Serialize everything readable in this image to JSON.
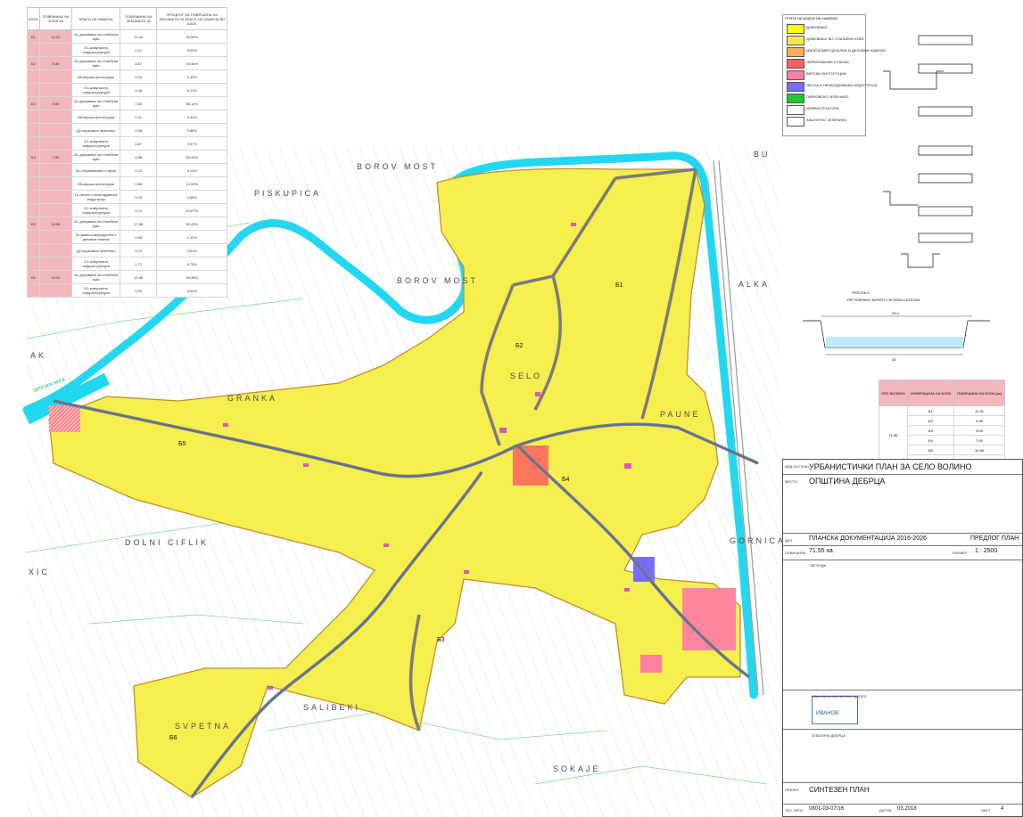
{
  "block_table": {
    "headers": [
      "БЛОК",
      "ПОВРШИНА НА БЛОК ха",
      "КЛАСА НА НАМЕНА",
      "ПОВРШИНА НА ЗЕМЈИШТЕ ха",
      "ПРОЦЕНТ НА ПОВРШИНА НА ЗЕМЈИШТЕ ЗА КЛАСА НА НАМЕНА ВО БЛОК"
    ],
    "rows": [
      {
        "block": "Б1",
        "area": "12.51",
        "class": "А1-домување во станбени куќи",
        "land": "11.64",
        "pct": "93.05%"
      },
      {
        "block": "",
        "area": "",
        "class": "Е1-комунална инфраструктура",
        "land": "1.07",
        "pct": "8.55%"
      },
      {
        "block": "Б2",
        "area": "9.39",
        "class": "А1-домување во станбени куќи",
        "land": "8.87",
        "pct": "94.46%"
      },
      {
        "block": "",
        "area": "",
        "class": "В5-верски институции",
        "land": "0.04",
        "pct": "0.43%"
      },
      {
        "block": "",
        "area": "",
        "class": "Е1-комунална инфраструктура",
        "land": "0.48",
        "pct": "5.11%"
      },
      {
        "block": "Б3",
        "area": "9.09",
        "class": "А1-домување во станбени куќи",
        "land": "7.83",
        "pct": "86.14%"
      },
      {
        "block": "",
        "area": "",
        "class": "В5-верски институции",
        "land": "0.31",
        "pct": "3.41%"
      },
      {
        "block": "",
        "area": "",
        "class": "Д2-парковско зеленило",
        "land": "0.08",
        "pct": "0.88%"
      },
      {
        "block": "",
        "area": "",
        "class": "Е1-комунална инфраструктура",
        "land": "0.87",
        "pct": "9.57%"
      },
      {
        "block": "Б4",
        "area": "7.00",
        "class": "А1-домување во станбени куќи",
        "land": "4.86",
        "pct": "69.43%"
      },
      {
        "block": "",
        "area": "",
        "class": "В1-образование и наука",
        "land": "0.22",
        "pct": "3.14%"
      },
      {
        "block": "",
        "area": "",
        "class": "В5-верски институции",
        "land": "0.98",
        "pct": "14.00%"
      },
      {
        "block": "",
        "area": "",
        "class": "Г2-лесна и незагадувачка индустрија",
        "land": "0.20",
        "pct": "2.86%"
      },
      {
        "block": "",
        "area": "",
        "class": "Е1-комунална инфраструктура",
        "land": "0.74",
        "pct": "10.57%"
      },
      {
        "block": "Б5",
        "area": "19.55",
        "class": "А1-домување во станбени куќи",
        "land": "17.68",
        "pct": "90.43%"
      },
      {
        "block": "",
        "area": "",
        "class": "Б1-мали комерцијални и деловни намени",
        "land": "0.06",
        "pct": "0.31%"
      },
      {
        "block": "",
        "area": "",
        "class": "Д2-парковско зеленило",
        "land": "0.10",
        "pct": "0.51%"
      },
      {
        "block": "",
        "area": "",
        "class": "Е1-комунална инфраструктура",
        "land": "1.71",
        "pct": "8.75%"
      },
      {
        "block": "Б6",
        "area": "14.01",
        "class": "А1-домување во станбени куќи",
        "land": "13.08",
        "pct": "93.36%"
      },
      {
        "block": "",
        "area": "",
        "class": "Е1-комунална инфраструктура",
        "land": "0.93",
        "pct": "6.64%"
      }
    ]
  },
  "localities": {
    "borov_most_1": "BOROV MOST",
    "borov_most_2": "BOROV MOST",
    "piskupica": "PISKUPICA",
    "granka": "GRANKA",
    "selo": "SELO",
    "dolni_ciflik": "DOLNI CIFLIK",
    "saliveki": "SALIBEKI",
    "sveti": "SVPETNA",
    "sokaje": "SOKAJE",
    "gorni": "GORNICA",
    "paune": "PAUNE",
    "ak": "AK",
    "xic": "XIC",
    "bu": "BU",
    "alka": "ALKA"
  },
  "block_labels": [
    "Б1",
    "Б2",
    "Б3",
    "Б4",
    "Б5",
    "Б6"
  ],
  "color_legend": {
    "title": "ГРУПА НА КЛАСИ НА НАМЕНИ",
    "items": [
      {
        "label": "ДОМУВАЊЕ",
        "color": "#ffff00"
      },
      {
        "label": "ДОМУВАЊЕ ВО СТАНБЕНИ КУЌИ",
        "color": "#f5e84a"
      },
      {
        "label": "МАЛИ КОМЕРЦИЈАЛНИ И ДЕЛОВНИ НАМЕНИ",
        "color": "#f5b05a"
      },
      {
        "label": "ОБРАЗОВАНИЕ И НАУКА",
        "color": "#ff6060"
      },
      {
        "label": "ВЕРСКИ ИНСТИТУЦИИ",
        "color": "#ff80a0"
      },
      {
        "label": "ЛЕСНА И НЕЗАГАДУВАЧКА ИНДУСТРИЈА",
        "color": "#7a6cff"
      },
      {
        "label": "ПАРКОВСКО ЗЕЛЕНИЛО",
        "color": "#22c830"
      },
      {
        "label": "ИНФРАСТРУКТУРА",
        "color": "#ffffff"
      },
      {
        "label": "ЗАШТИТНО ЗЕЛЕНИЛО",
        "color": "#ffffff"
      }
    ]
  },
  "upz_table": {
    "headers": [
      "УПС ВОЛИНО",
      "НУМЕРАЦИЈА НА БЛОК",
      "ПОВРШИНА НА БЛОК (ха)"
    ],
    "total": "71.55",
    "rows": [
      {
        "block": "Б1",
        "area": "12.51"
      },
      {
        "block": "Б2",
        "area": "9.39"
      },
      {
        "block": "Б3",
        "area": "9.09"
      },
      {
        "block": "Б4",
        "area": "7.00"
      },
      {
        "block": "Б5",
        "area": "19.55"
      },
      {
        "block": "Б6",
        "area": "14.01"
      }
    ]
  },
  "title_block": {
    "plan_label": "ВИД НА ПЛАН",
    "plan_name": "УРБАНИСТИЧКИ ПЛАН ЗА СЕЛО ВОЛИНО",
    "place_label": "МЕСТО",
    "municipality": "ОПШТИНА ДЕБРЦА",
    "doc_label": "ДЕЛ",
    "doc_name": "ПЛАНСКА ДОКУМЕНТАЦИЈА 2016-2026",
    "stage": "ПРЕДЛОГ ПЛАН",
    "area_label": "ПОВРШИНА",
    "area": "71.55 ха",
    "scale_label": "РАЗМЕР",
    "scale": "1 : 2500",
    "legend_label": "ЛЕГЕНДА",
    "maker": "ИВАНОВ ИНЖЕНЕРИНГ ДООЕЛ",
    "logo_text": "ИВАНОВ",
    "orderer_label": "ОРАЗОВАНИЕ",
    "orderer": "ОПШТИНА ДЕБРЦА",
    "drawing_label": "ПРИЛОГ",
    "drawing": "СИНТЕЗЕН ПЛАН",
    "tech_label": "ТЕХ. БРОЈ",
    "tech_no": "0801-03-07/16",
    "date_label": "ДАТУМ",
    "date": "03.2018",
    "sheet_label": "ЛИСТ",
    "sheet": "4"
  },
  "sections": {
    "title": "ПРЕСЕК А",
    "subtitle": "РЕГУЛИРАНО КОРИТО НА РЕКА САТЕСКА",
    "dim_top": "25.4",
    "dim_bottom": "25"
  },
  "river_label": "SATESKA REKA"
}
